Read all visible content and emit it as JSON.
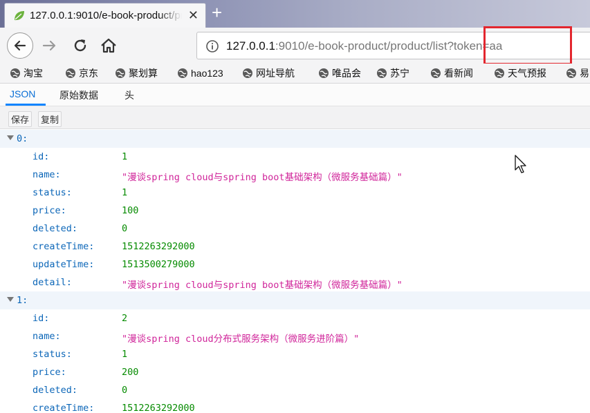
{
  "tab": {
    "title": "127.0.0.1:9010/e-book-product/product/list?token=aa",
    "close_glyph": "✕",
    "new_tab_glyph": "+",
    "favicon": "leaf-icon"
  },
  "nav": {
    "url_host": "127.0.0.1",
    "url_rest": ":9010/e-book-product/product/list?token=aa",
    "highlight_color": "#e3262e"
  },
  "bookmarks": [
    "淘宝",
    "京东",
    "聚划算",
    "hao123",
    "网址导航",
    "唯品会",
    "苏宁",
    "看新闻",
    "天气预报",
    "易"
  ],
  "viewer": {
    "tabs": [
      "JSON",
      "原始数据",
      "头"
    ],
    "actions": [
      "保存",
      "复制"
    ]
  },
  "json": {
    "items": [
      {
        "index": "0:",
        "fields": [
          {
            "key": "id:",
            "value": "1",
            "type": "num"
          },
          {
            "key": "name:",
            "value": "\"漫谈spring cloud与spring boot基础架构（微服务基础篇）\"",
            "type": "str"
          },
          {
            "key": "status:",
            "value": "1",
            "type": "num"
          },
          {
            "key": "price:",
            "value": "100",
            "type": "num"
          },
          {
            "key": "deleted:",
            "value": "0",
            "type": "num"
          },
          {
            "key": "createTime:",
            "value": "1512263292000",
            "type": "num"
          },
          {
            "key": "updateTime:",
            "value": "1513500279000",
            "type": "num"
          },
          {
            "key": "detail:",
            "value": "\"漫谈spring cloud与spring boot基础架构（微服务基础篇）\"",
            "type": "str"
          }
        ]
      },
      {
        "index": "1:",
        "fields": [
          {
            "key": "id:",
            "value": "2",
            "type": "num"
          },
          {
            "key": "name:",
            "value": "\"漫谈spring cloud分布式服务架构（微服务进阶篇）\"",
            "type": "str"
          },
          {
            "key": "status:",
            "value": "1",
            "type": "num"
          },
          {
            "key": "price:",
            "value": "200",
            "type": "num"
          },
          {
            "key": "deleted:",
            "value": "0",
            "type": "num"
          },
          {
            "key": "createTime:",
            "value": "1512263292000",
            "type": "num"
          }
        ]
      }
    ]
  }
}
